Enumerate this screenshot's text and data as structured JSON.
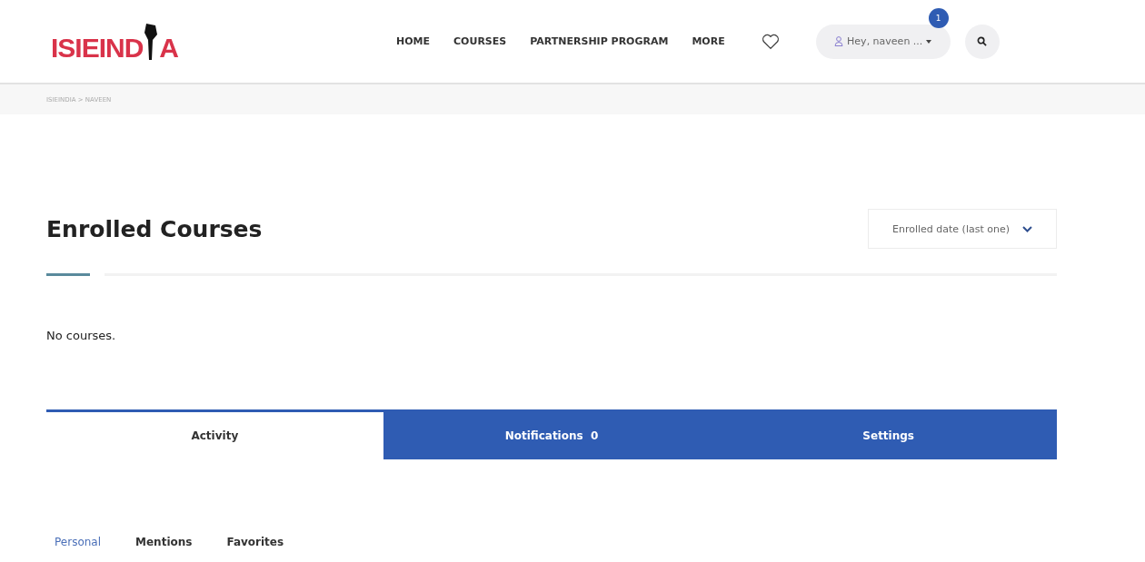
{
  "logo": {
    "before": "ISIEIND",
    "after": "A"
  },
  "nav": [
    {
      "label": "HOME"
    },
    {
      "label": "COURSES"
    },
    {
      "label": "PARTNERSHIP PROGRAM"
    },
    {
      "label": "MORE"
    }
  ],
  "user_menu": {
    "label": "Hey, naveen ...",
    "badge": "1"
  },
  "breadcrumb": "ISIEINDIA > NAVEEN",
  "section": {
    "title": "Enrolled Courses",
    "sort": "Enrolled date (last one)",
    "empty": "No courses."
  },
  "tabs": [
    {
      "label": "Activity",
      "selected": true
    },
    {
      "label": "Notifications  0",
      "selected": false
    },
    {
      "label": "Settings",
      "selected": false
    }
  ],
  "subtabs": [
    {
      "label": "Personal",
      "selected": true
    },
    {
      "label": "Mentions",
      "selected": false
    },
    {
      "label": "Favorites",
      "selected": false
    }
  ]
}
